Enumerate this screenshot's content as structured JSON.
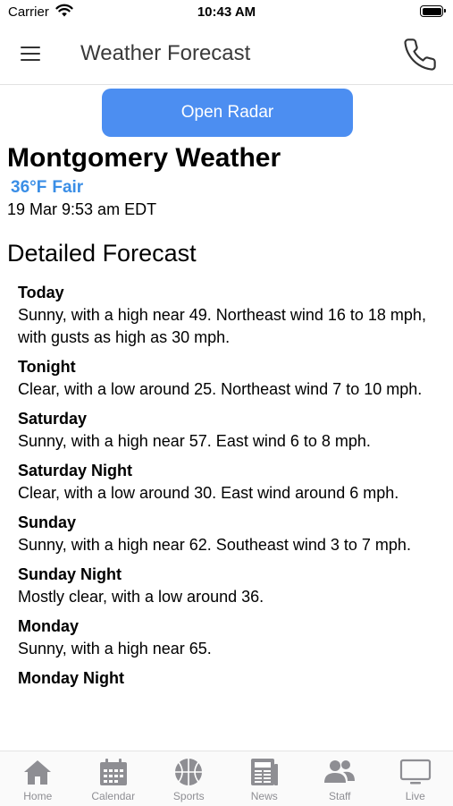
{
  "status_bar": {
    "carrier": "Carrier",
    "time": "10:43 AM"
  },
  "nav": {
    "title": "Weather Forecast",
    "menu_icon": "hamburger-menu-icon",
    "phone_icon": "phone-icon"
  },
  "radar_button": {
    "label": "Open Radar",
    "color": "#4c8ef1"
  },
  "current": {
    "city_title": "Montgomery Weather",
    "temperature": "36°F",
    "condition": "Fair",
    "observed": "19 Mar 9:53 am EDT",
    "accent_color": "#3a8ee6"
  },
  "detailed": {
    "title": "Detailed Forecast",
    "periods": [
      {
        "name": "Today",
        "text": "Sunny, with a high near 49. Northeast wind 16 to 18 mph, with gusts as high as 30 mph."
      },
      {
        "name": "Tonight",
        "text": "Clear, with a low around 25. Northeast wind 7 to 10 mph."
      },
      {
        "name": "Saturday",
        "text": "Sunny, with a high near 57. East wind 6 to 8 mph."
      },
      {
        "name": "Saturday Night",
        "text": "Clear, with a low around 30. East wind around 6 mph."
      },
      {
        "name": "Sunday",
        "text": "Sunny, with a high near 62. Southeast wind 3 to 7 mph."
      },
      {
        "name": "Sunday Night",
        "text": "Mostly clear, with a low around 36."
      },
      {
        "name": "Monday",
        "text": "Sunny, with a high near 65."
      },
      {
        "name": "Monday Night",
        "text": ""
      }
    ]
  },
  "tabs": [
    {
      "label": "Home",
      "icon": "home-icon"
    },
    {
      "label": "Calendar",
      "icon": "calendar-icon"
    },
    {
      "label": "Sports",
      "icon": "basketball-icon"
    },
    {
      "label": "News",
      "icon": "newspaper-icon"
    },
    {
      "label": "Staff",
      "icon": "people-icon"
    },
    {
      "label": "Live",
      "icon": "tv-icon"
    }
  ]
}
